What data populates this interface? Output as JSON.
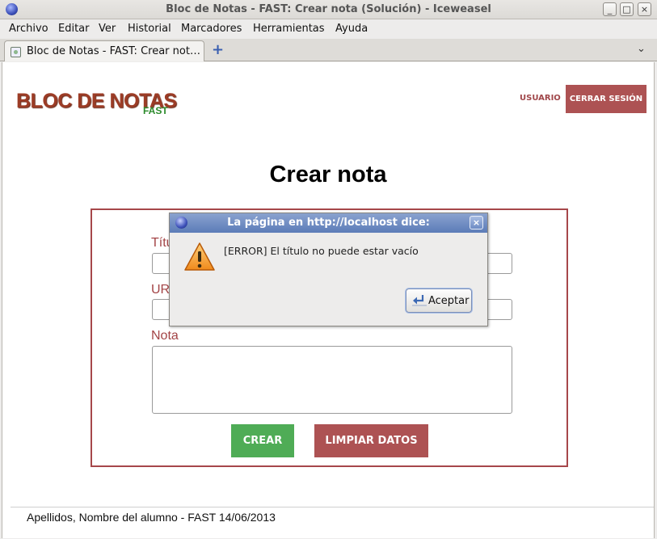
{
  "window": {
    "title": "Bloc de Notas - FAST: Crear nota (Solución) - Iceweasel",
    "buttons": [
      "_",
      "□",
      "×"
    ]
  },
  "menubar": {
    "items": [
      "Archivo",
      "Editar",
      "Ver",
      "Historial",
      "Marcadores",
      "Herramientas",
      "Ayuda"
    ]
  },
  "tabs": {
    "active_label": "Bloc de Notas - FAST: Crear not…",
    "new_tab_glyph": "+",
    "list_glyph": "⌄"
  },
  "page": {
    "logo_main": "BLOC DE NOTAS",
    "logo_sub": "FAST",
    "user_link": "USUARIO",
    "logout_button": "CERRAR SESIÓN",
    "title": "Crear nota",
    "form": {
      "title_label": "Títu",
      "url_label": "UR",
      "note_label": "Nota",
      "title_value": "",
      "url_value": "",
      "note_value": ""
    },
    "create_button": "CREAR",
    "clear_button": "LIMPIAR DATOS",
    "footer": "Apellidos, Nombre del alumno - FAST 14/06/2013"
  },
  "dialog": {
    "title": "La página en http://localhost dice:",
    "message": "[ERROR] El título no puede estar vacío",
    "ok_button": "Aceptar",
    "close_glyph": "×"
  },
  "colors": {
    "brand_red": "#ad5253",
    "brand_green": "#4fac56",
    "dialog_title": "#6c88c0"
  }
}
